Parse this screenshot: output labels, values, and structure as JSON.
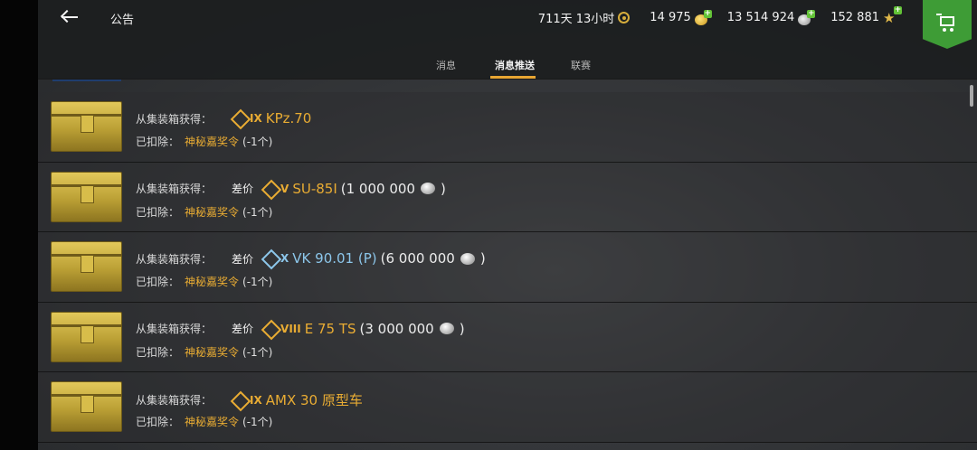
{
  "header": {
    "title": "公告",
    "playtime": "711天 13小时",
    "gold": "14 975",
    "credits": "13 514 924",
    "free_xp": "152 881",
    "icons": {
      "back": "back-arrow-icon",
      "playtime": "laurel-icon",
      "gold": "gold-coin-icon",
      "credits": "silver-coin-icon",
      "free_xp": "star-icon",
      "shop": "shopping-cart-icon"
    }
  },
  "tabs": [
    {
      "label": "消息",
      "active": false
    },
    {
      "label": "消息推送",
      "active": true
    },
    {
      "label": "联赛",
      "active": false
    }
  ],
  "rows": [
    {
      "source_label": "从集装箱获得：",
      "price_diff_label": "",
      "tier": "IX",
      "tank": "KPz.70",
      "tank_color": "gold",
      "price": "",
      "deducted_label": "已扣除：",
      "item": "神秘嘉奖令",
      "count": "(-1个)"
    },
    {
      "source_label": "从集装箱获得：",
      "price_diff_label": "差价",
      "tier": "V",
      "tank": "SU-85I",
      "tank_color": "gold",
      "price": "(1 000 000",
      "deducted_label": "已扣除：",
      "item": "神秘嘉奖令",
      "count": "(-1个)"
    },
    {
      "source_label": "从集装箱获得：",
      "price_diff_label": "差价",
      "tier": "X",
      "tank": "VK 90.01 (P)",
      "tank_color": "blue",
      "price": "(6 000 000",
      "deducted_label": "已扣除：",
      "item": "神秘嘉奖令",
      "count": "(-1个)"
    },
    {
      "source_label": "从集装箱获得：",
      "price_diff_label": "差价",
      "tier": "VIII",
      "tank": "E 75 TS",
      "tank_color": "gold",
      "price": "(3 000 000",
      "deducted_label": "已扣除：",
      "item": "神秘嘉奖令",
      "count": "(-1个)"
    },
    {
      "source_label": "从集装箱获得：",
      "price_diff_label": "",
      "tier": "IX",
      "tank": "AMX 30 原型车",
      "tank_color": "gold",
      "price": "",
      "deducted_label": "已扣除：",
      "item": "神秘嘉奖令",
      "count": "(-1个)"
    }
  ],
  "colors": {
    "accent": "#e9ac33",
    "tank_gold": "#e9ac33",
    "tank_blue": "#8cc6ea",
    "shop_green": "#3e9c36",
    "plus_green": "#62c236"
  }
}
